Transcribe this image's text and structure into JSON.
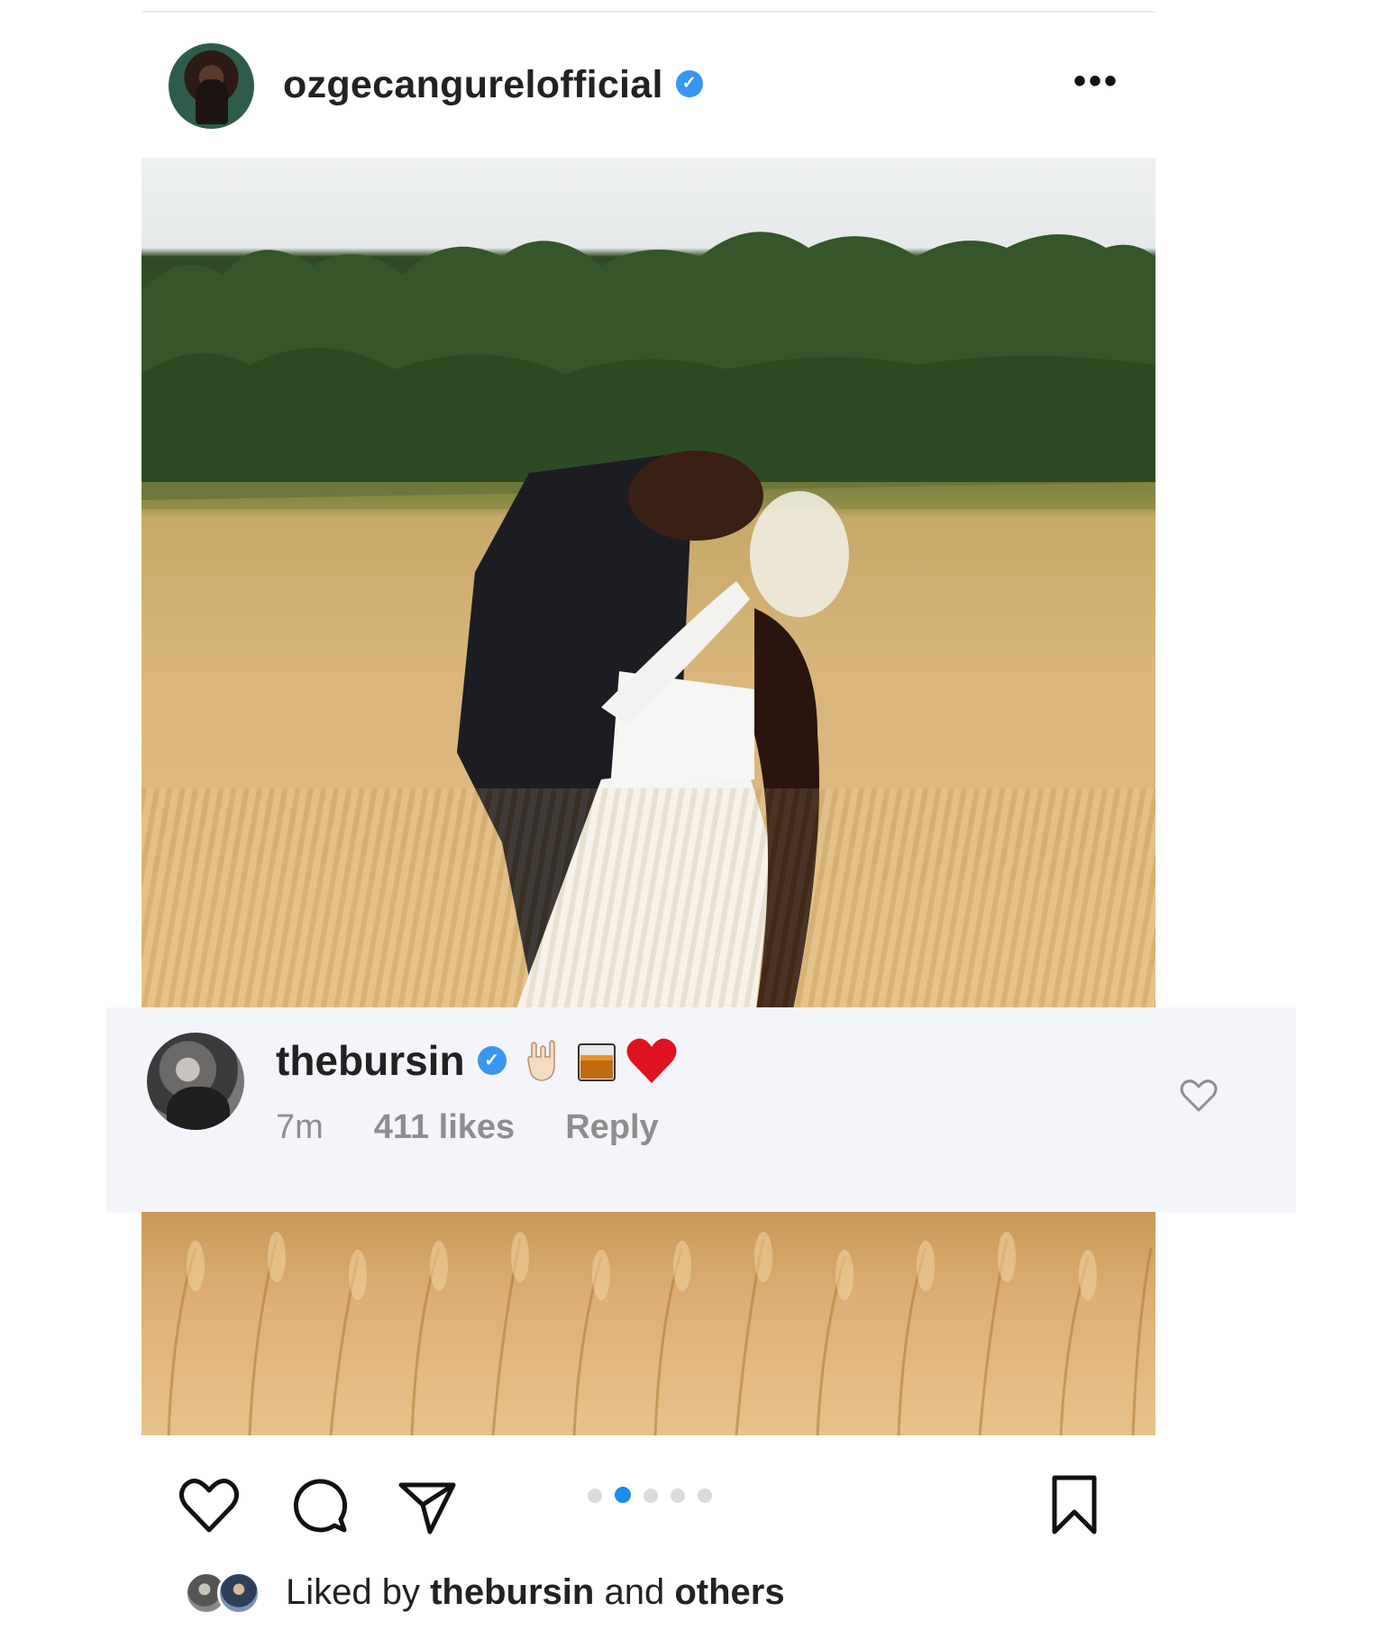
{
  "post": {
    "username": "ozgecangurelofficial",
    "verified": true,
    "more_label": "•••"
  },
  "comment": {
    "username": "thebursin",
    "verified": true,
    "emojis": [
      "rock-hand",
      "whisky-glass",
      "red-heart"
    ],
    "time": "7m",
    "likes": "411 likes",
    "reply": "Reply"
  },
  "carousel": {
    "total": 5,
    "active_index": 1
  },
  "liked_by": {
    "prefix": "Liked by",
    "user": "thebursin",
    "and": "and",
    "others": "others"
  },
  "colors": {
    "verified_blue": "#3897f0",
    "active_dot": "#1a8cf0",
    "comment_bg": "#f3f5fa",
    "meta_gray": "#8e8e8e"
  }
}
